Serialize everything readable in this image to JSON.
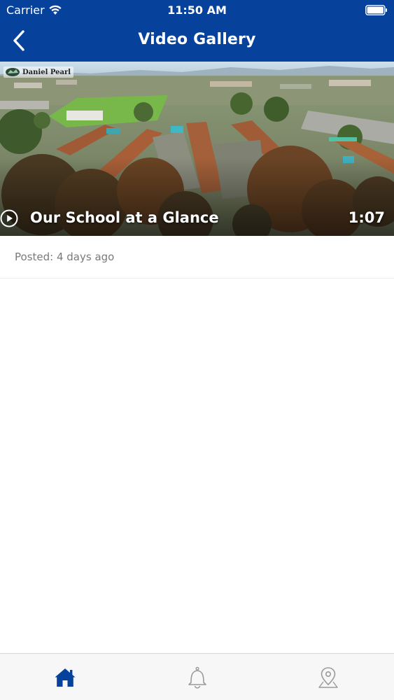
{
  "status_bar": {
    "carrier": "Carrier",
    "time": "11:50 AM",
    "icons": [
      "wifi-icon",
      "battery-icon"
    ]
  },
  "nav": {
    "title": "Video Gallery",
    "back_icon": "chevron-left-icon"
  },
  "video": {
    "title": "Our School at a Glance",
    "duration": "1:07",
    "posted": "Posted: 4 days ago",
    "logo_text": "Daniel Pearl",
    "play_icon": "play-circle-icon"
  },
  "tabs": [
    {
      "icon": "home-icon",
      "active": true
    },
    {
      "icon": "bell-icon",
      "active": false
    },
    {
      "icon": "map-pin-icon",
      "active": false
    }
  ],
  "colors": {
    "brand": "#06429c",
    "tab_active": "#06429c",
    "tab_inactive": "#9a9a9a",
    "muted_text": "#7a7a7a"
  }
}
